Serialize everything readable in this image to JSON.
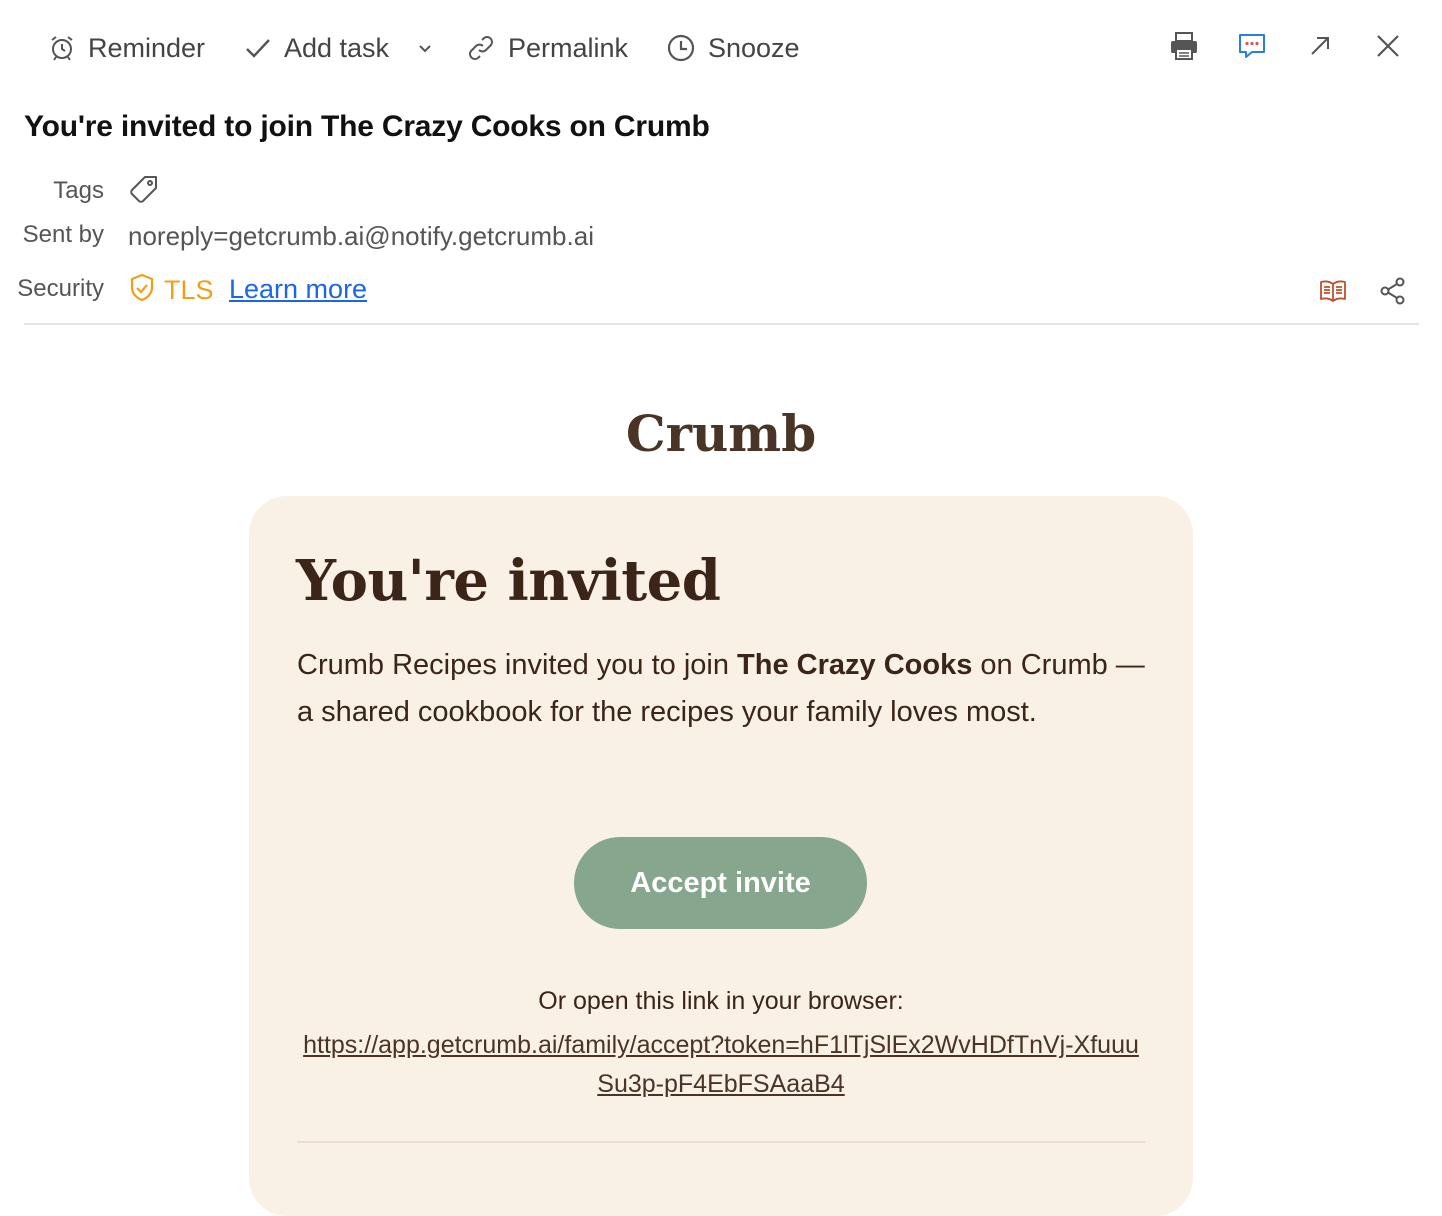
{
  "toolbar": {
    "reminder_label": "Reminder",
    "add_task_label": "Add task",
    "permalink_label": "Permalink",
    "snooze_label": "Snooze",
    "icons": [
      "alarm-clock-icon",
      "checkmark-icon",
      "chevron-down-icon",
      "link-icon",
      "clock-icon",
      "print-icon",
      "chat-icon",
      "popout-icon",
      "close-icon"
    ]
  },
  "email": {
    "subject": "You're invited to join The Crazy Cooks on Crumb",
    "tags_label": "Tags",
    "sent_by_label": "Sent by",
    "sender": "noreply=getcrumb.ai@notify.getcrumb.ai",
    "security_label": "Security",
    "security_value": "TLS",
    "learn_more": "Learn more"
  },
  "content": {
    "brand": "Crumb",
    "title": "You're invited",
    "body_pre": "Crumb Recipes invited you to join ",
    "body_bold": "The Crazy Cooks",
    "body_post": " on Crumb — a shared cookbook for the recipes your family loves most.",
    "button_label": "Accept invite",
    "or_open": "Or open this link in your browser:",
    "link": "https://app.getcrumb.ai/family/accept?token=hF1lTjSlEx2WvHDfTnVj-XfuuuSu3p-pF4EbFSAaaB4"
  },
  "colors": {
    "accent_tls": "#f0a018",
    "link_blue": "#1a66e8",
    "brand_brown": "#4a3426",
    "card_bg": "#f9f1e6",
    "button_green": "#86a68d"
  }
}
